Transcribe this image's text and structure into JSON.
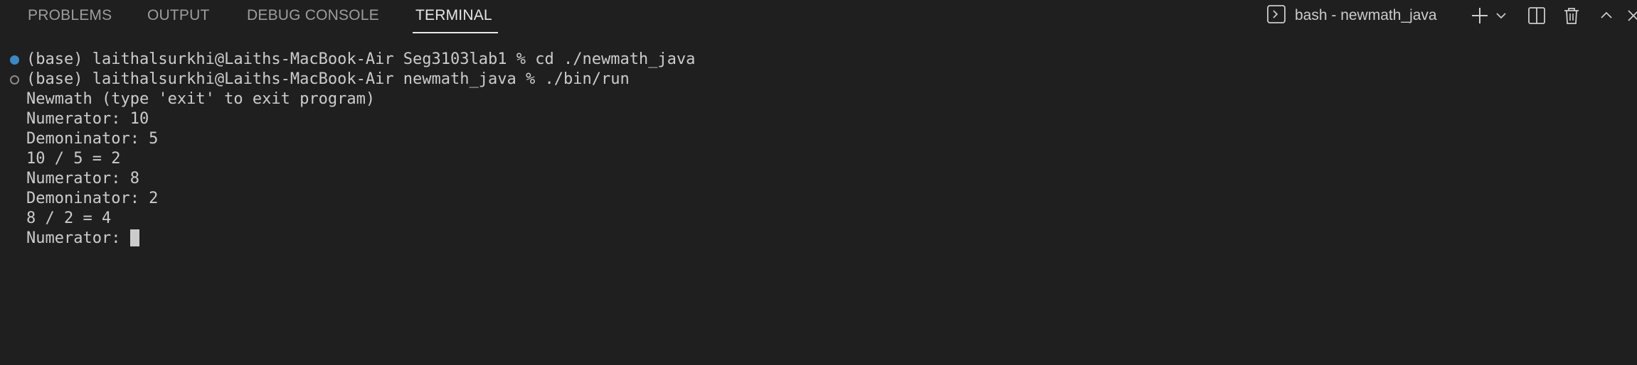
{
  "panel": {
    "tabs": [
      {
        "label": "PROBLEMS"
      },
      {
        "label": "OUTPUT"
      },
      {
        "label": "DEBUG CONSOLE"
      },
      {
        "label": "TERMINAL"
      }
    ],
    "active_tab": "TERMINAL",
    "shell_label": "bash - newmath_java",
    "icons": [
      "terminal-icon",
      "plus-icon",
      "chevron-down-icon",
      "split-terminal-icon",
      "trash-icon",
      "chevron-up-icon",
      "close-icon"
    ]
  },
  "terminal": {
    "lines": [
      "(base) laithalsurkhi@Laiths-MacBook-Air Seg3103lab1 % cd ./newmath_java",
      "(base) laithalsurkhi@Laiths-MacBook-Air newmath_java % ./bin/run",
      "Newmath (type 'exit' to exit program)",
      "Numerator: 10",
      "Demoninator: 5",
      "10 / 5 = 2",
      "Numerator: 8",
      "Demoninator: 2",
      "8 / 2 = 4",
      "Numerator: "
    ]
  },
  "colors": {
    "background": "#1f1f1f",
    "text": "#cccccc",
    "tab_inactive": "#9d9d9d",
    "tab_active": "#e7e7e7",
    "command_marker_success": "#3b88c3",
    "command_marker_running": "#8a8a8a"
  }
}
